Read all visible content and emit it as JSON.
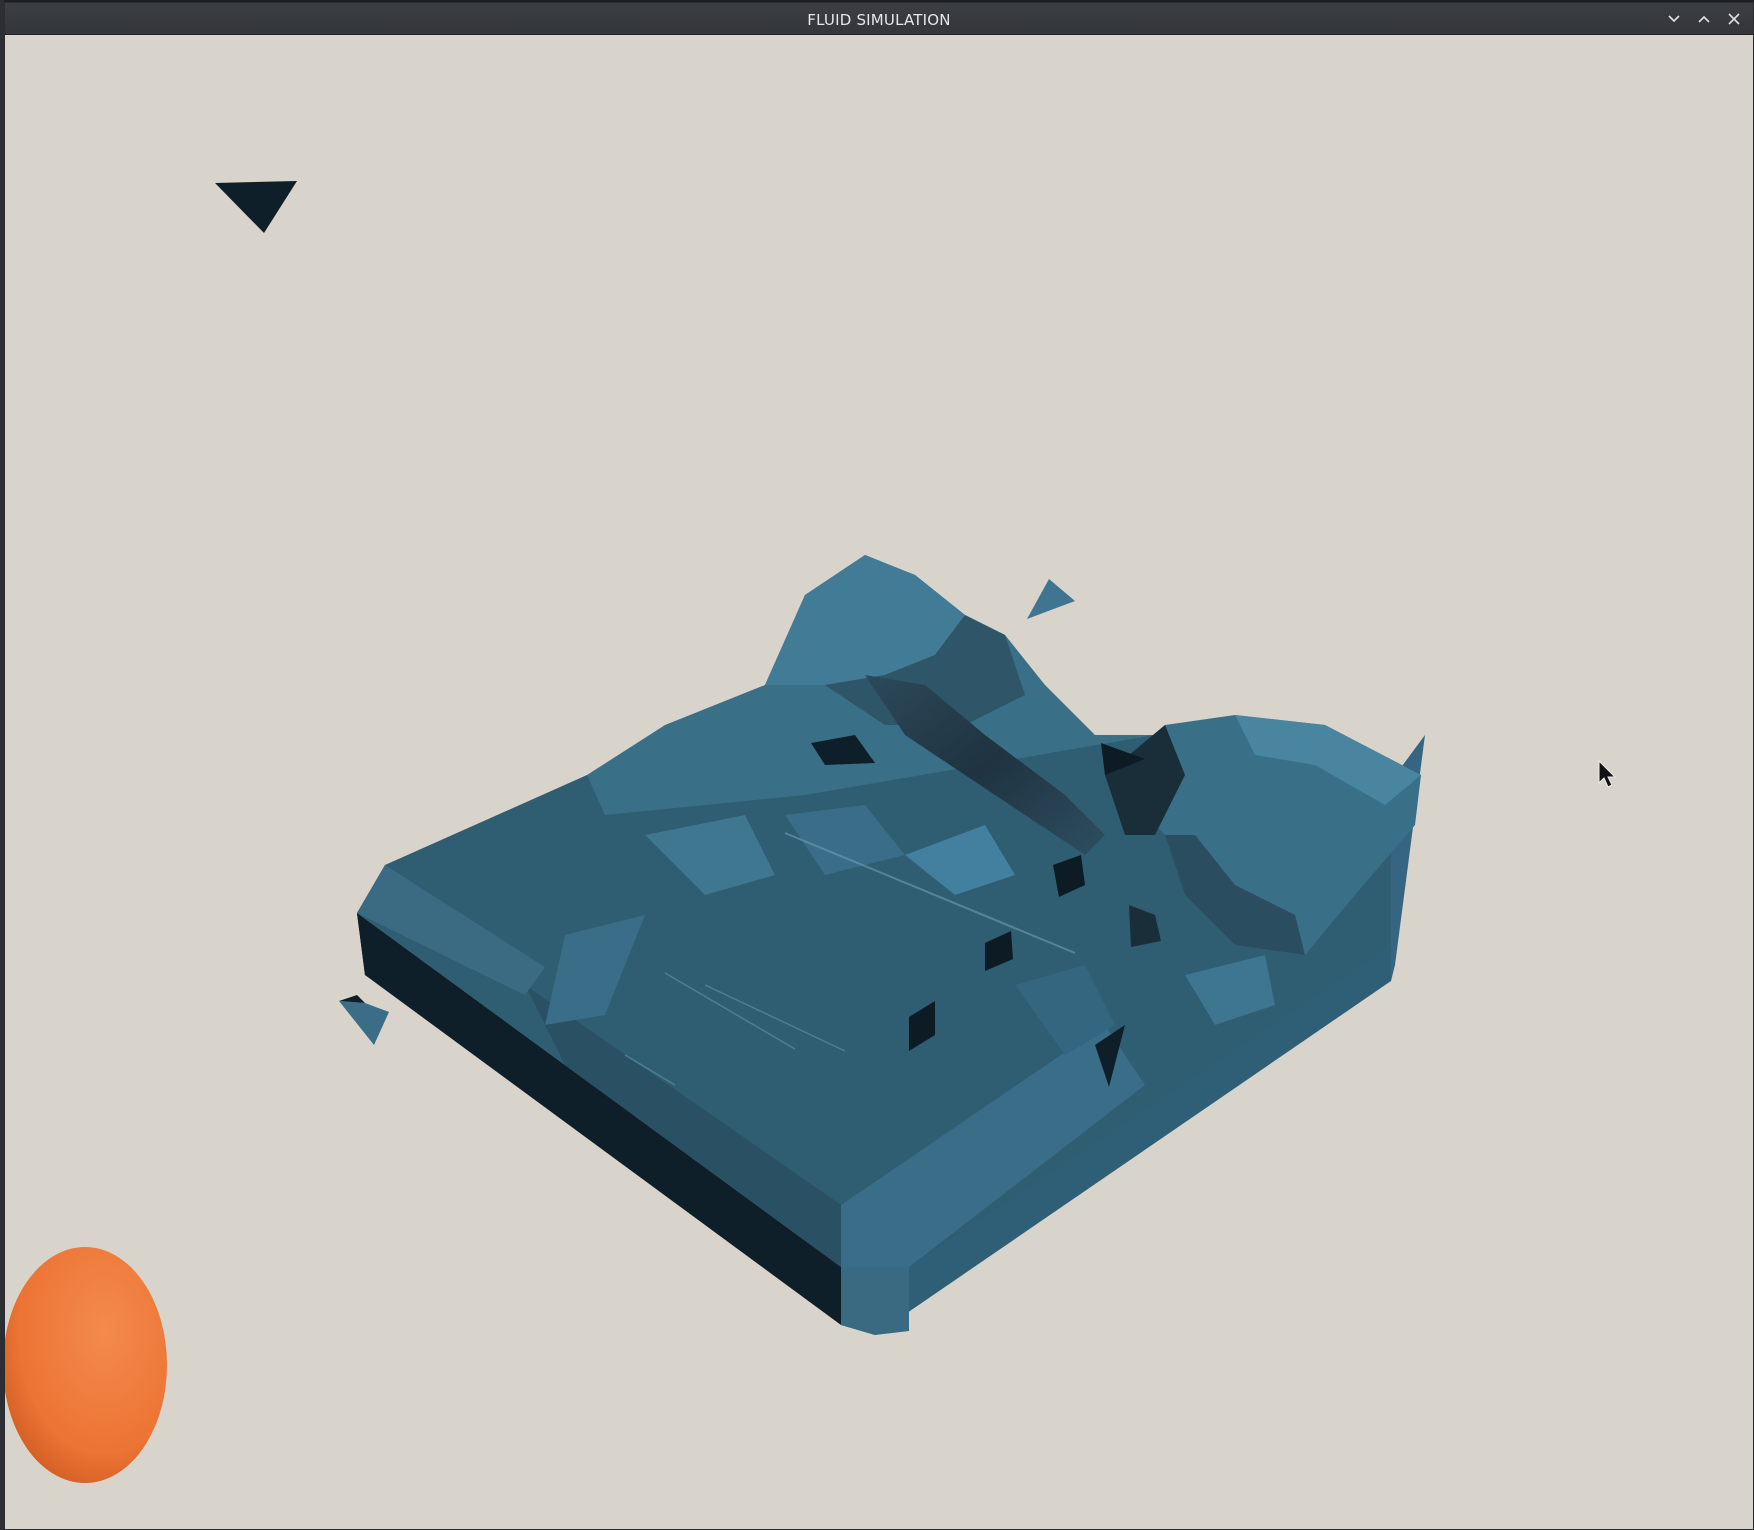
{
  "window": {
    "title": "FLUID SIMULATION",
    "controls": {
      "minimize_icon": "chevron-down-icon",
      "maximize_icon": "chevron-up-icon",
      "close_icon": "close-icon"
    }
  },
  "scene": {
    "background_color": "#d8d4cb",
    "fluid_color": "#3e6f88",
    "fluid_shadow_color": "#0f1f29",
    "sphere_color": "#ec7434",
    "cursor_icon": "mouse-pointer-icon"
  }
}
